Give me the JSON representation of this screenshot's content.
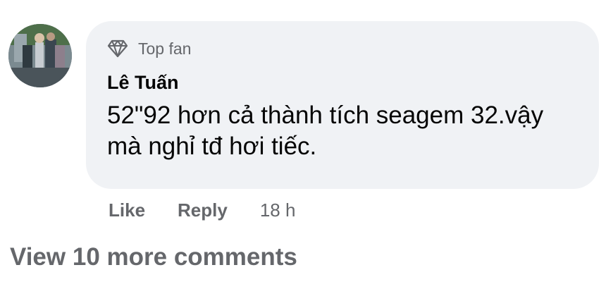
{
  "comment": {
    "badge": {
      "icon": "diamond-icon",
      "label": "Top fan"
    },
    "author": "Lê Tuấn",
    "text": "52\"92 hơn cả thành tích seagem 32.vậy mà nghỉ tđ hơi tiếc.",
    "actions": {
      "like": "Like",
      "reply": "Reply",
      "time": "18 h"
    }
  },
  "view_more": "View 10 more comments",
  "colors": {
    "bubble_bg": "#f0f2f5",
    "secondary_text": "#65676b",
    "primary_text": "#050505"
  }
}
